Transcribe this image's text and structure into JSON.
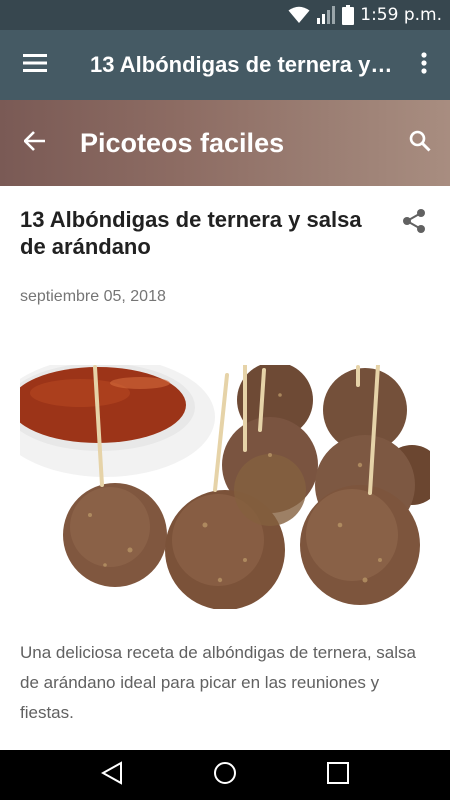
{
  "status_bar": {
    "time": "1:59 p.m.",
    "icons": [
      "wifi-icon",
      "signal-icon",
      "battery-icon"
    ]
  },
  "app_bar": {
    "title": "13 Albóndigas de ternera y salsa de arándano",
    "icons": [
      "menu-icon",
      "more-vert-icon"
    ]
  },
  "blog_header": {
    "title": "Picoteos faciles",
    "icons": [
      "arrow-back-icon",
      "search-icon"
    ]
  },
  "post": {
    "title": "13 Albóndigas de ternera y salsa de arándano",
    "date": "septiembre 05, 2018",
    "snippet": "Una deliciosa receta de albóndigas de ternera, salsa de arándano ideal para picar en las reuniones y fiestas.",
    "icons": [
      "share-icon"
    ]
  },
  "nav_bar": {
    "icons": [
      "back-triangle-icon",
      "home-circle-icon",
      "recents-square-icon"
    ]
  },
  "colors": {
    "status_bar": "#37474f",
    "app_bar": "#455a64",
    "blog_header": "#8d6c63"
  }
}
